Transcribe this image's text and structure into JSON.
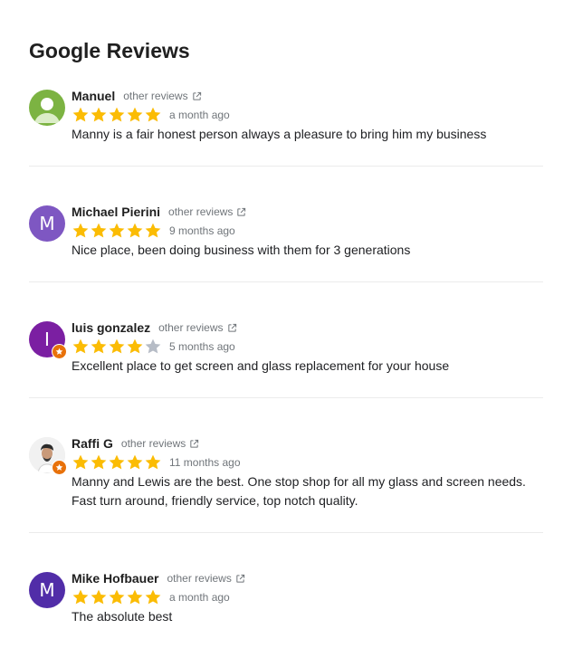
{
  "title": "Google Reviews",
  "colors": {
    "star_filled": "#fbbc04",
    "star_empty": "#b6bcc6",
    "badge": "#e8710a"
  },
  "reviews": [
    {
      "name": "Manuel",
      "link": "other reviews",
      "rating": 5,
      "date": "a month ago",
      "text": "Manny is a fair honest person always a pleasure to bring him my business",
      "avatar": {
        "type": "silhouette",
        "color": "#7cb342"
      },
      "badge": false
    },
    {
      "name": "Michael Pierini",
      "link": "other reviews",
      "rating": 5,
      "date": "9 months ago",
      "text": "Nice place, been doing business with them for 3 generations",
      "avatar": {
        "type": "letter",
        "letter": "M",
        "color": "#7e57c2"
      },
      "badge": false
    },
    {
      "name": "luis gonzalez",
      "link": "other reviews",
      "rating": 4,
      "date": "5 months ago",
      "text": "Excellent place to get screen and glass replacement for your house",
      "avatar": {
        "type": "letter",
        "letter": "I",
        "color": "#7b1fa2"
      },
      "badge": true
    },
    {
      "name": "Raffi G",
      "link": "other reviews",
      "rating": 5,
      "date": "11 months ago",
      "text": "Manny and Lewis are the best. One stop shop for all my glass and screen needs. Fast turn around, friendly service, top notch quality.",
      "avatar": {
        "type": "photo",
        "color": "#e9e9e9"
      },
      "badge": true
    },
    {
      "name": "Mike Hofbauer",
      "link": "other reviews",
      "rating": 5,
      "date": "a month ago",
      "text": "The absolute best",
      "avatar": {
        "type": "letter",
        "letter": "M",
        "color": "#512da8"
      },
      "badge": false
    }
  ]
}
